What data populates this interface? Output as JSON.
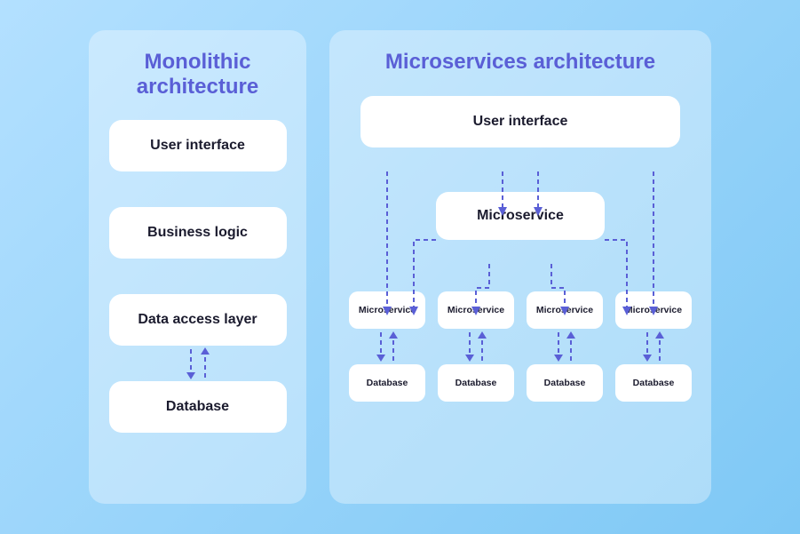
{
  "monolithic": {
    "title": "Monolithic architecture",
    "layers": [
      "User interface",
      "Business logic",
      "Data access layer",
      "Database"
    ]
  },
  "microservices": {
    "title": "Microservices architecture",
    "ui": "User interface",
    "gateway": "Microservice",
    "services": [
      "Microservice",
      "Microservice",
      "Microservice",
      "Microservice"
    ],
    "databases": [
      "Database",
      "Database",
      "Database",
      "Database"
    ]
  }
}
